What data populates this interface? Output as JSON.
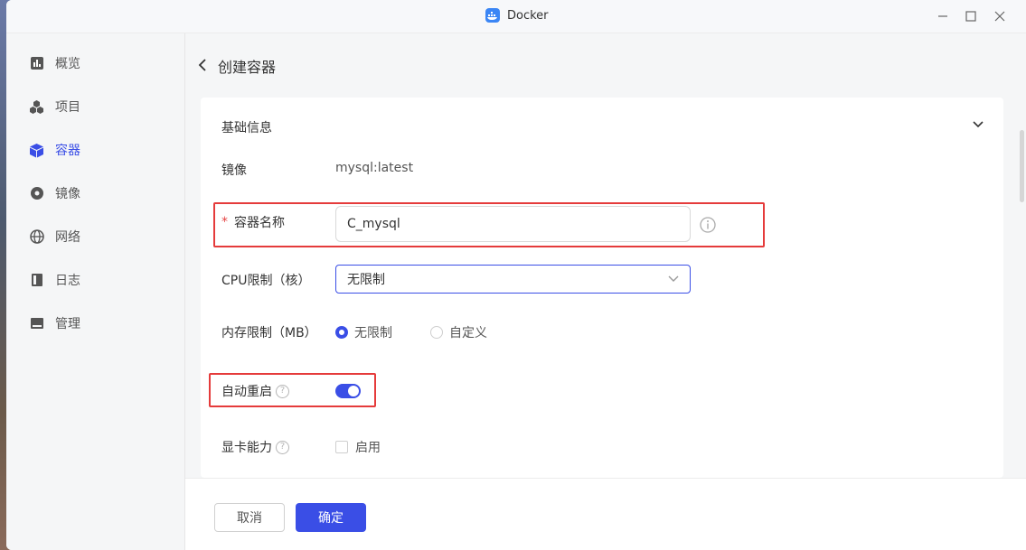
{
  "window": {
    "title": "Docker"
  },
  "sidebar": {
    "items": [
      {
        "label": "概览",
        "icon": "overview-icon"
      },
      {
        "label": "项目",
        "icon": "project-icon"
      },
      {
        "label": "容器",
        "icon": "container-icon",
        "active": true
      },
      {
        "label": "镜像",
        "icon": "image-icon"
      },
      {
        "label": "网络",
        "icon": "network-icon"
      },
      {
        "label": "日志",
        "icon": "log-icon"
      },
      {
        "label": "管理",
        "icon": "manage-icon"
      }
    ]
  },
  "page": {
    "title": "创建容器"
  },
  "form": {
    "section_title": "基础信息",
    "image_label": "镜像",
    "image_value": "mysql:latest",
    "name_label": "容器名称",
    "name_value": "C_mysql",
    "cpu_label": "CPU限制（核）",
    "cpu_value": "无限制",
    "memory_label": "内存限制（MB）",
    "memory_options": [
      "无限制",
      "自定义"
    ],
    "memory_selected": "无限制",
    "autorestart_label": "自动重启",
    "autorestart_on": true,
    "gpu_label": "显卡能力",
    "gpu_checkbox_label": "启用"
  },
  "footer": {
    "cancel_label": "取消",
    "ok_label": "确定"
  },
  "colors": {
    "accent": "#3a4ee6",
    "highlight": "#e53b3b"
  }
}
